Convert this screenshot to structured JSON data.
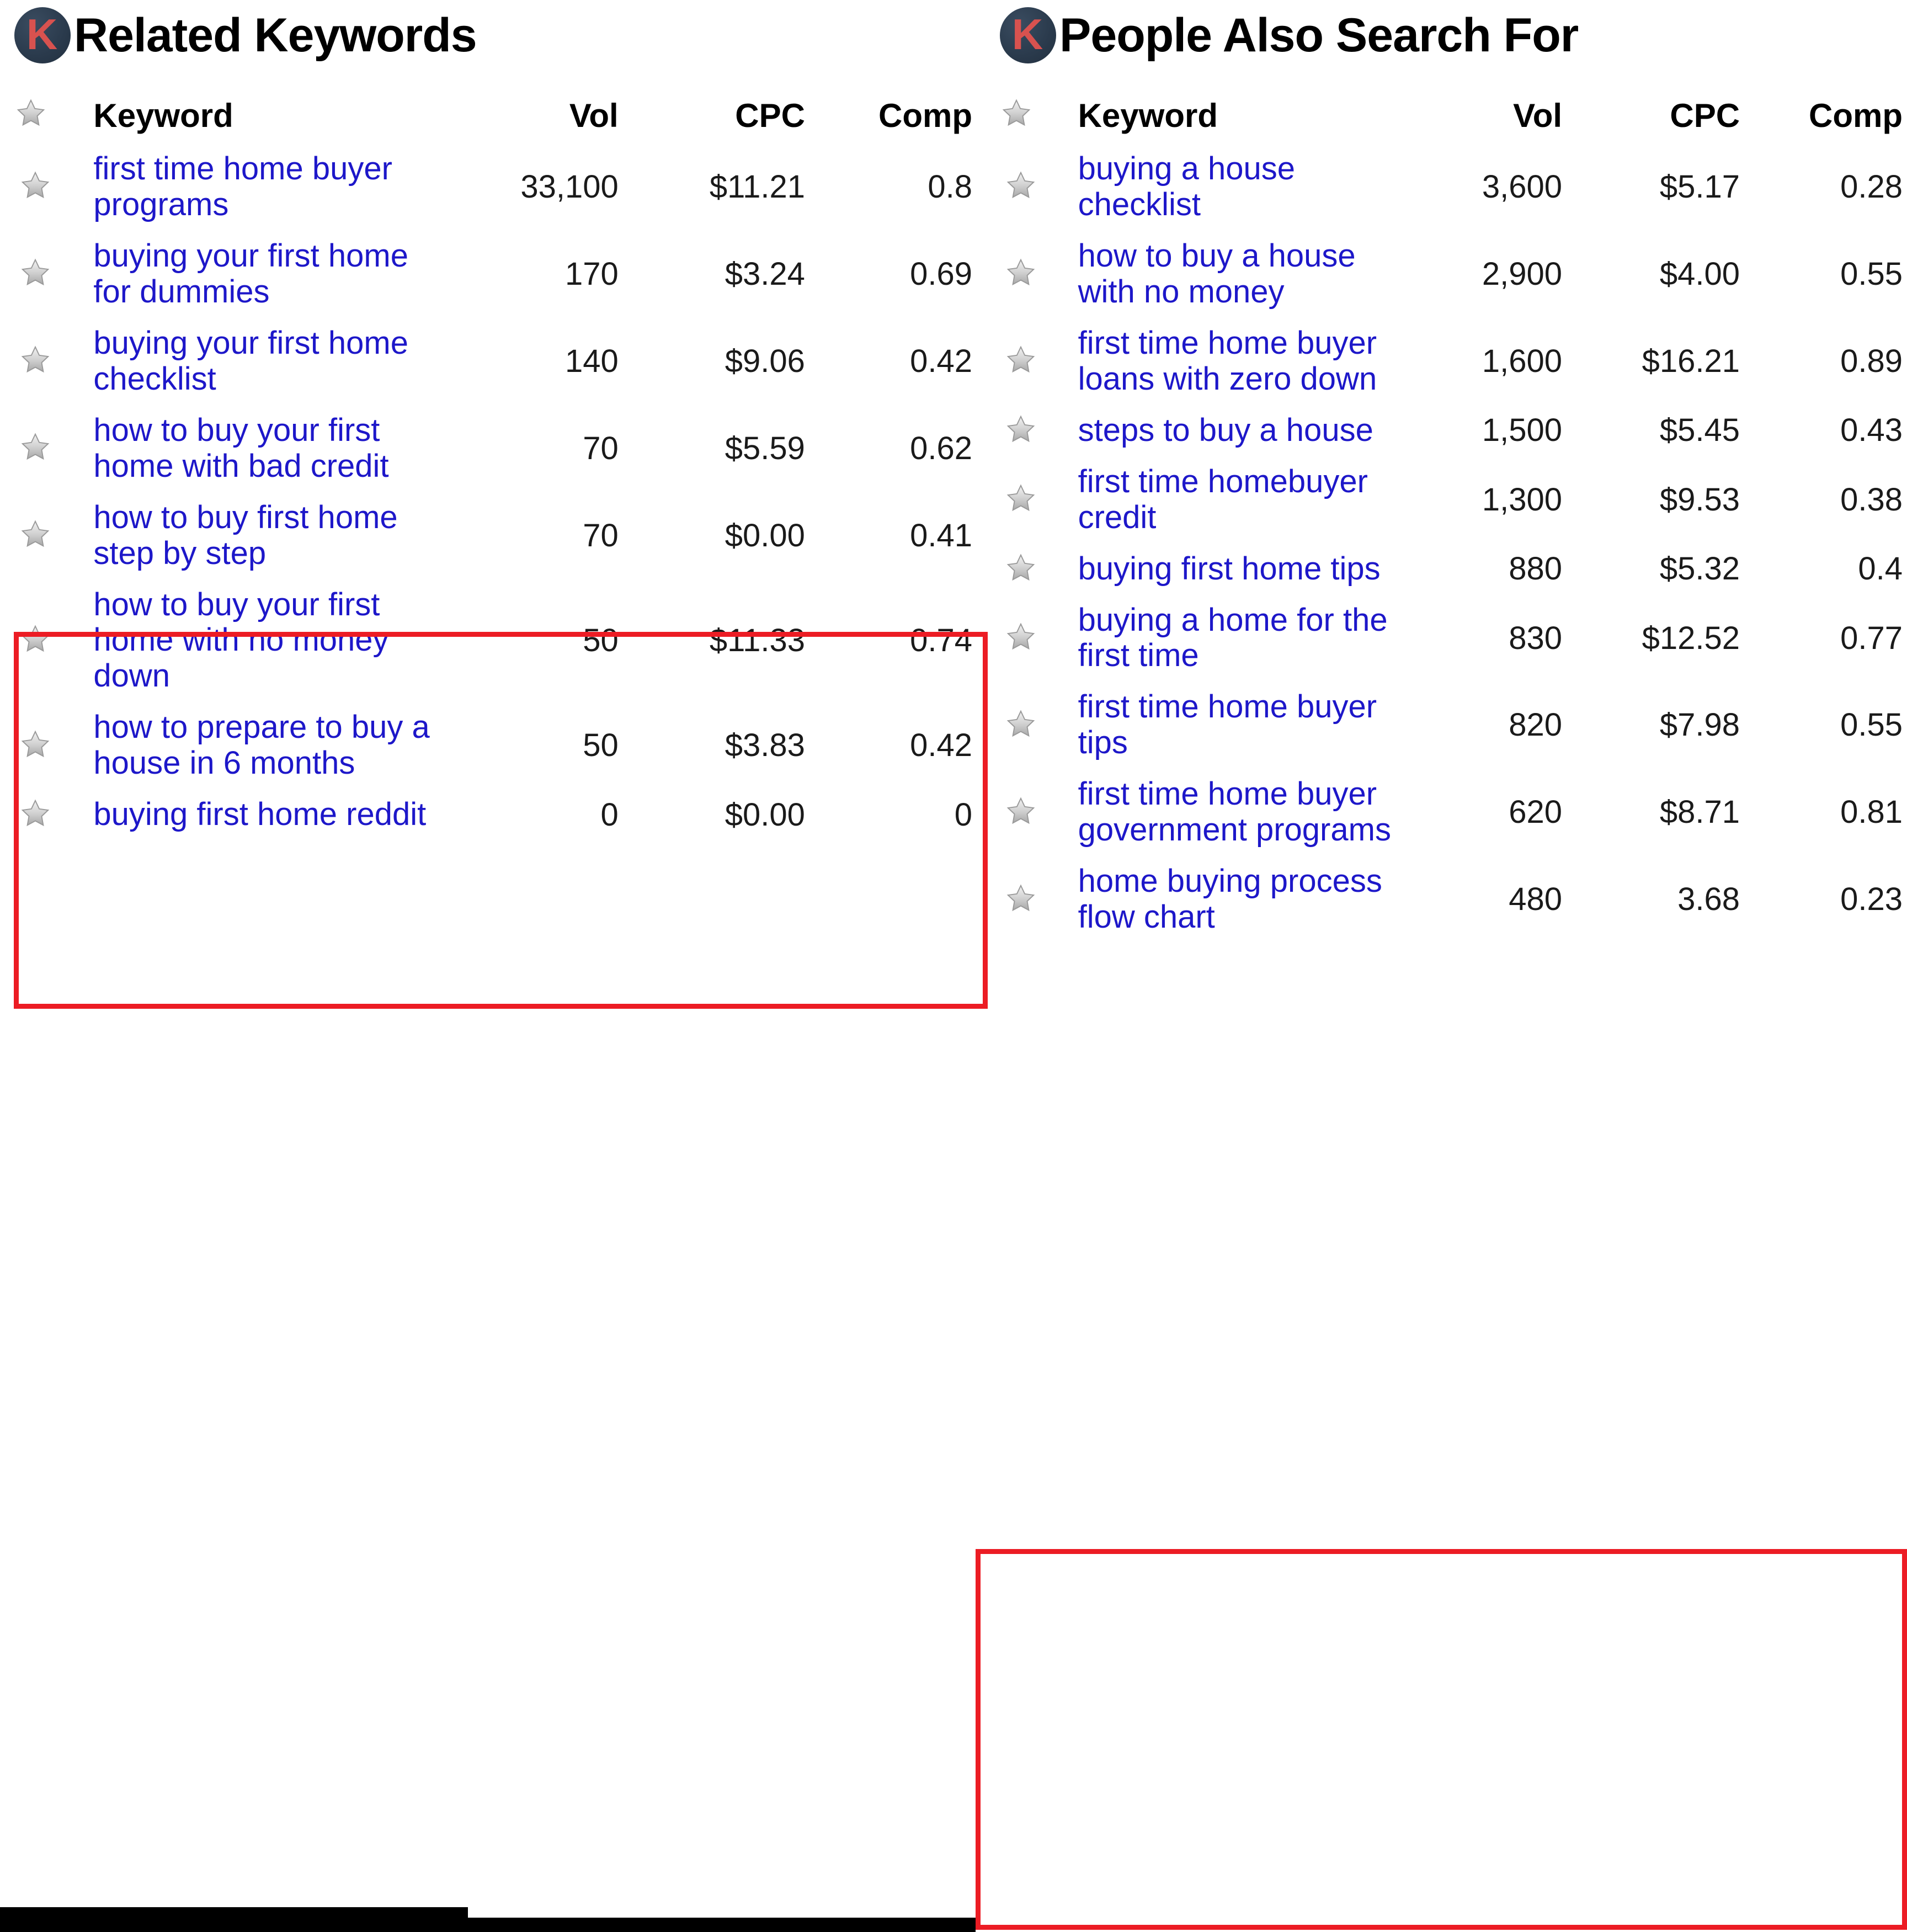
{
  "panels": [
    {
      "title": "Related Keywords",
      "logo_letter": "K",
      "logo_colors": {
        "disc": "#2a3a4c",
        "letter": "#d8524f"
      },
      "columns": {
        "star": "",
        "keyword": "Keyword",
        "vol": "Vol",
        "cpc": "CPC",
        "comp": "Comp"
      },
      "rows": [
        {
          "keyword": "first time home buyer programs",
          "vol": "33,100",
          "cpc": "$11.21",
          "comp": "0.8"
        },
        {
          "keyword": "buying your first home for dummies",
          "vol": "170",
          "cpc": "$3.24",
          "comp": "0.69"
        },
        {
          "keyword": "buying your first home checklist",
          "vol": "140",
          "cpc": "$9.06",
          "comp": "0.42"
        },
        {
          "keyword": "how to buy your first home with bad credit",
          "vol": "70",
          "cpc": "$5.59",
          "comp": "0.62"
        },
        {
          "keyword": "how to buy first home step by step",
          "vol": "70",
          "cpc": "$0.00",
          "comp": "0.41"
        },
        {
          "keyword": "how to buy your first home with no money down",
          "vol": "50",
          "cpc": "$11.33",
          "comp": "0.74"
        },
        {
          "keyword": "how to prepare to buy a house in 6 months",
          "vol": "50",
          "cpc": "$3.83",
          "comp": "0.42"
        },
        {
          "keyword": "buying first home reddit",
          "vol": "0",
          "cpc": "$0.00",
          "comp": "0"
        }
      ],
      "highlight": {
        "color": "#ec1c24",
        "from_row": 2,
        "to_row": 3
      }
    },
    {
      "title": "People Also Search For",
      "logo_letter": "K",
      "logo_colors": {
        "disc": "#2a3a4c",
        "letter": "#d8524f"
      },
      "columns": {
        "star": "",
        "keyword": "Keyword",
        "vol": "Vol",
        "cpc": "CPC",
        "comp": "Comp"
      },
      "rows": [
        {
          "keyword": "buying a house checklist",
          "vol": "3,600",
          "cpc": "$5.17",
          "comp": "0.28"
        },
        {
          "keyword": "how to buy a house with no money",
          "vol": "2,900",
          "cpc": "$4.00",
          "comp": "0.55"
        },
        {
          "keyword": "first time home buyer loans with zero down",
          "vol": "1,600",
          "cpc": "$16.21",
          "comp": "0.89"
        },
        {
          "keyword": "steps to buy a house",
          "vol": "1,500",
          "cpc": "$5.45",
          "comp": "0.43"
        },
        {
          "keyword": "first time homebuyer credit",
          "vol": "1,300",
          "cpc": "$9.53",
          "comp": "0.38"
        },
        {
          "keyword": "buying first home tips",
          "vol": "880",
          "cpc": "$5.32",
          "comp": "0.4"
        },
        {
          "keyword": "buying a home for the first time",
          "vol": "830",
          "cpc": "$12.52",
          "comp": "0.77"
        },
        {
          "keyword": "first time home buyer tips",
          "vol": "820",
          "cpc": "$7.98",
          "comp": "0.55"
        },
        {
          "keyword": "first time home buyer government programs",
          "vol": "620",
          "cpc": "$8.71",
          "comp": "0.81"
        },
        {
          "keyword": "home buying process flow chart",
          "vol": "480",
          "cpc": "3.68",
          "comp": "0.23"
        }
      ],
      "highlight": {
        "color": "#ec1c24",
        "from_row": 8,
        "to_row": 9
      }
    }
  ],
  "icons": {
    "star": "star-icon",
    "logo": "keyword-tool-logo-icon"
  }
}
